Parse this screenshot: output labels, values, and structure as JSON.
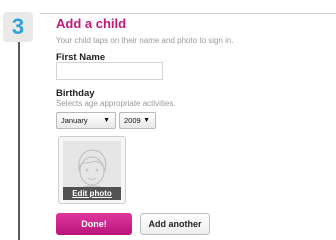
{
  "step": {
    "number": "3"
  },
  "form": {
    "title": "Add a child",
    "subtitle": "Your child taps on their name and photo to sign in.",
    "first_name": {
      "label": "First Name",
      "value": "",
      "placeholder": ""
    },
    "birthday": {
      "label": "Birthday",
      "hint": "Selects age appropriate activities.",
      "month": "January",
      "year": "2009"
    },
    "photo": {
      "edit_label": "Edit photo"
    },
    "buttons": {
      "done": "Done!",
      "add_another": "Add another"
    }
  },
  "colors": {
    "accent": "#c2187a",
    "step_number": "#2ea3d6",
    "button_done": "#d12a8f"
  }
}
